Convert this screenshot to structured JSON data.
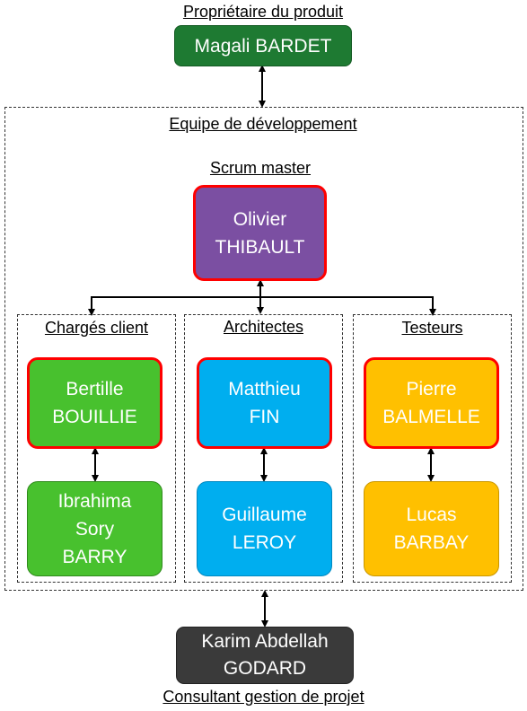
{
  "colors": {
    "dark_green": "#1e7a32",
    "purple": "#7b4fa2",
    "green": "#48c12e",
    "blue": "#00aeef",
    "orange": "#ffc000",
    "dark": "#3a3a3a",
    "red_border": "#ff0000"
  },
  "owner": {
    "title": "Propriétaire du produit",
    "name": "Magali BARDET"
  },
  "team": {
    "title": "Equipe de développement",
    "scrum_master": {
      "title": "Scrum master",
      "name": "Olivier\nTHIBAULT"
    },
    "groups": [
      {
        "title": "Chargés client",
        "lead": "Bertille\nBOUILLIE",
        "member": "Ibrahima\nSory\nBARRY"
      },
      {
        "title": "Architectes",
        "lead": "Matthieu\nFIN",
        "member": "Guillaume\nLEROY"
      },
      {
        "title": "Testeurs",
        "lead": "Pierre\nBALMELLE",
        "member": "Lucas\nBARBAY"
      }
    ]
  },
  "consultant": {
    "name": "Karim Abdellah\nGODARD",
    "title": "Consultant gestion de projet"
  }
}
